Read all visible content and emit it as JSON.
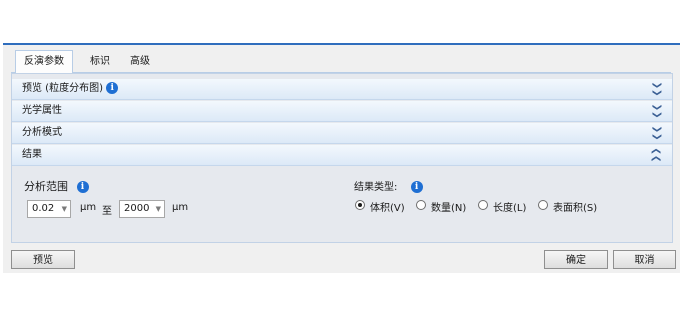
{
  "tabs": [
    {
      "label": "反演参数",
      "active": true
    },
    {
      "label": "标识"
    },
    {
      "label": "高级"
    }
  ],
  "sections": {
    "preview": {
      "title": "预览 (粒度分布图)",
      "state": "collapsed"
    },
    "optical": {
      "title": "光学属性",
      "state": "collapsed"
    },
    "analysis_mode": {
      "title": "分析模式",
      "state": "collapsed"
    },
    "results": {
      "title": "结果",
      "state": "expanded"
    }
  },
  "chevrons": {
    "collapsed": "❯❯",
    "expanded": "❯❯"
  },
  "results": {
    "range_label": "分析范围",
    "min_value": "0.02",
    "min_unit": "µm",
    "to_label": "至",
    "max_value": "2000",
    "max_unit": "µm",
    "type_label": "结果类型:",
    "types": [
      {
        "label": "体积(V)",
        "checked": true
      },
      {
        "label": "数量(N)",
        "checked": false
      },
      {
        "label": "长度(L)",
        "checked": false
      },
      {
        "label": "表面积(S)",
        "checked": false
      }
    ]
  },
  "buttons": {
    "preview": "预览",
    "ok": "确定",
    "cancel": "取消"
  },
  "icons": {
    "info": "i",
    "combo_arrow": "▼"
  },
  "colors": {
    "accent": "#2f6dbd",
    "info": "#1f6fd3",
    "panel": "#e6e9ee"
  }
}
